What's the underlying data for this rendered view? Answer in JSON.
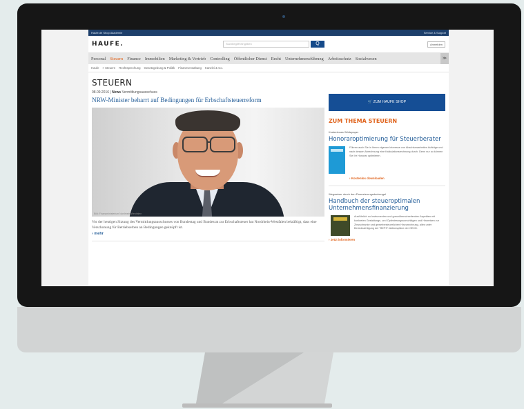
{
  "topbar": {
    "left": "Haufe.de  Shop  Akademie",
    "right": "Service & Support"
  },
  "header": {
    "logo": "HAUFE.",
    "search_placeholder": "Suchbegriff eingeben",
    "search_icon": "Q",
    "login": "Anmelden"
  },
  "mainnav": {
    "items": [
      "Personal",
      "Steuern",
      "Finance",
      "Immobilien",
      "Marketing & Vertrieb",
      "Controlling",
      "Öffentlicher Dienst",
      "Recht",
      "Unternehmensführung",
      "Arbeitsschutz",
      "Sozialwesen"
    ],
    "next": "≫"
  },
  "subnav": {
    "items": [
      "Haufe",
      "> Steuern",
      "Rechtsprechung",
      "Gesetzgebung & Politik",
      "Finanzverwaltung",
      "Kanzlei & Co."
    ]
  },
  "article": {
    "section_title": "STEUERN",
    "date": "08.09.2016",
    "category": "News",
    "topic": "Vermittlungsausschuss",
    "headline": "NRW-Minister beharrt auf Bedingungen für Erbschaftsteuerreform",
    "photo_caption": "Bild: Finanzministerium Nordrhein-Westfalen",
    "teaser": "Vor der heutigen Sitzung des Vermittlungsausschusses von Bundestag und Bundesrat zur Erbschaftsteuer hat Nordrhein-Westfalen bekräftigt, dass eine Verschonung für Betriebserben an Bedingungen geknüpft ist.",
    "more": "mehr"
  },
  "sidebar": {
    "shop_button": "ZUM HAUFE SHOP",
    "box_title": "ZUM THEMA STEUERN",
    "kicker1": "Kostenloses Whitepaper",
    "head1": "Honoraroptimierung für Steuerberater",
    "text1": "Führen auch Sie in Ihrem eigenen Interesse von Abschlussarbeiten Aufträge und nach dessen Abrechnung eine Kalkulationsrechnung durch. Denn nur so können Sie Ihr Honorar optimieren.",
    "download": "Kostenlos downloaden",
    "kicker2": "Wegweiser durch den Finanzierungsdschungel",
    "head2": "Handbuch der steueroptimalen Unternehmensfinanzierung",
    "text2": "Ausführlich zu Instrumenten und grenzüberschreitenden Aspekten mit konkreten Gestaltungs- und Optimierungsvorschlägen und Hinweisen zur Zinsschranke und gewerbesteuerlichen Hinzurechnung, alles unter Berücksichtigung der \"BEPS\"-Aktionspläne der OECD.",
    "more_info": "Jetzt informieren"
  }
}
